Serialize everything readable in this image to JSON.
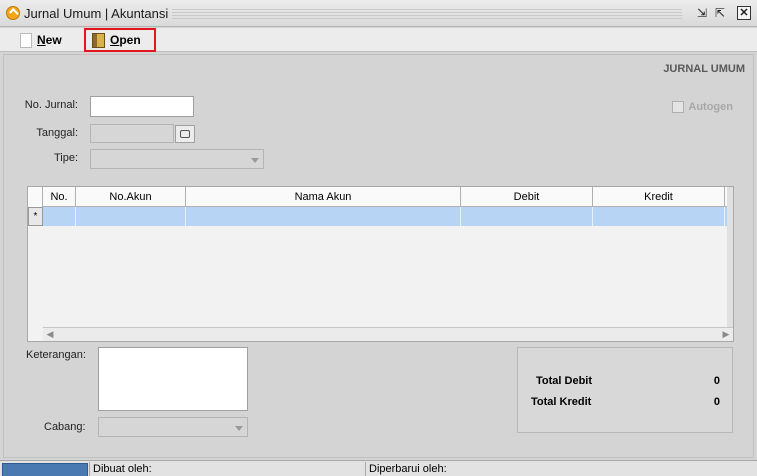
{
  "window": {
    "title": "Jurnal Umum | Akuntansi",
    "controls": {
      "restore": "⇲",
      "maximize": "⇱",
      "close": "✕"
    }
  },
  "toolbar": {
    "new_label": "New",
    "open_label": "Open"
  },
  "form": {
    "title": "JURNAL UMUM",
    "no_jurnal_label": "No. Jurnal:",
    "no_jurnal_value": "",
    "tanggal_label": "Tanggal:",
    "tanggal_value": "",
    "tipe_label": "Tipe:",
    "tipe_value": "",
    "autogen_label": "Autogen",
    "keterangan_label": "Keterangan:",
    "cabang_label": "Cabang:",
    "cabang_value": ""
  },
  "grid": {
    "columns": [
      "No.",
      "No.Akun",
      "Nama Akun",
      "Debit",
      "Kredit"
    ],
    "new_row_marker": "*",
    "rows": []
  },
  "totals": {
    "debit_label": "Total Debit",
    "debit_value": "0",
    "kredit_label": "Total Kredit",
    "kredit_value": "0"
  },
  "status": {
    "dibuat_label": "Dibuat oleh:",
    "diperbarui_label": "Diperbarui oleh:"
  }
}
